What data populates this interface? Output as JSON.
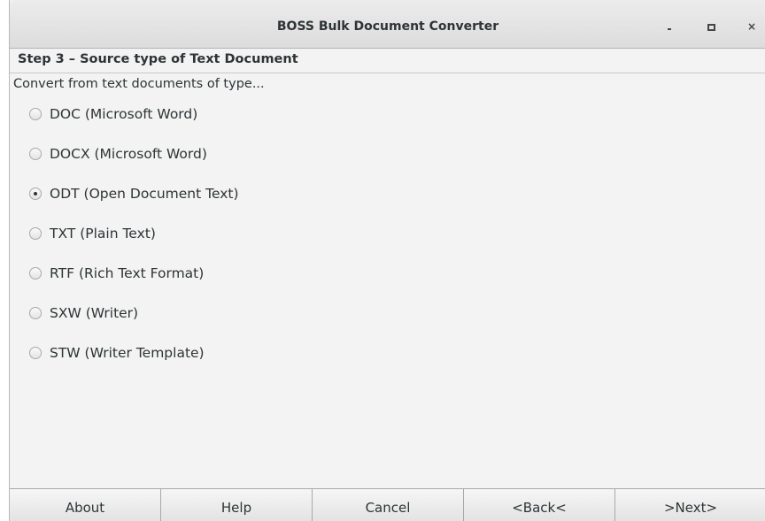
{
  "window": {
    "title": "BOSS Bulk Document Converter",
    "controls": {
      "minimize_icon": "minimize-icon",
      "maximize_icon": "maximize-icon",
      "close_icon": "close-icon"
    }
  },
  "step": {
    "title": "Step 3 – Source type of Text Document",
    "instruction": "Convert from text documents of type..."
  },
  "options": [
    {
      "label": "DOC (Microsoft Word)",
      "selected": false
    },
    {
      "label": "DOCX (Microsoft Word)",
      "selected": false
    },
    {
      "label": "ODT (Open Document Text)",
      "selected": true
    },
    {
      "label": "TXT (Plain Text)",
      "selected": false
    },
    {
      "label": "RTF (Rich Text Format)",
      "selected": false
    },
    {
      "label": "SXW (Writer)",
      "selected": false
    },
    {
      "label": "STW (Writer Template)",
      "selected": false
    }
  ],
  "buttons": {
    "about": "About",
    "help": "Help",
    "cancel": "Cancel",
    "back": "<Back<",
    "next": ">Next>"
  }
}
